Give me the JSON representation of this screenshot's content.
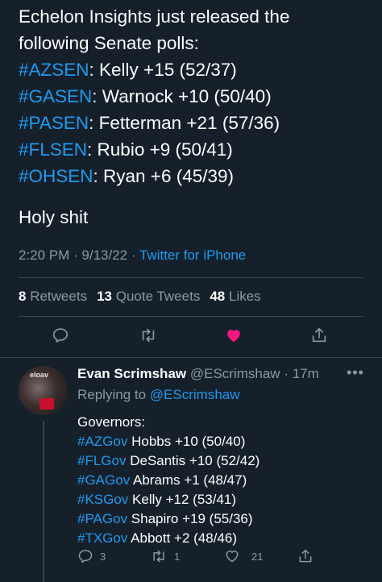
{
  "tweet": {
    "lines": [
      {
        "text": "Echelon Insights just released the"
      },
      {
        "text": "following Senate polls:"
      },
      {
        "tag": "#AZSEN",
        "rest": ": Kelly +15 (52/37)"
      },
      {
        "tag": "#GASEN",
        "rest": ": Warnock +10 (50/40)"
      },
      {
        "tag": "#PASEN",
        "rest": ": Fetterman +21 (57/36)"
      },
      {
        "tag": "#FLSEN",
        "rest": ": Rubio +9 (50/41)"
      },
      {
        "tag": "#OHSEN",
        "rest": ": Ryan +6 (45/39)"
      }
    ],
    "closing": "Holy shit",
    "time": "2:20 PM",
    "date": "9/13/22",
    "source": "Twitter for iPhone"
  },
  "stats": {
    "retweets_count": "8",
    "retweets_label": "Retweets",
    "quotes_count": "13",
    "quotes_label": "Quote Tweets",
    "likes_count": "48",
    "likes_label": "Likes"
  },
  "colors": {
    "background": "#15202b",
    "link": "#1d9bf0",
    "like": "#f91880",
    "muted": "#8b98a5"
  },
  "reply": {
    "name": "Evan Scrimshaw",
    "handle": "@EScrimshaw",
    "time": "17m",
    "replying_to_prefix": "Replying to",
    "replying_to": "@EScrimshaw",
    "avatar_logo_text": "eloav",
    "heading": "Governors:",
    "lines": [
      {
        "tag": "#AZGov",
        "rest": " Hobbs +10 (50/40)"
      },
      {
        "tag": "#FLGov",
        "rest": " DeSantis +10 (52/42)"
      },
      {
        "tag": "#GAGov",
        "rest": " Abrams +1 (48/47)"
      },
      {
        "tag": "#KSGov",
        "rest": " Kelly +12 (53/41)"
      },
      {
        "tag": "#PAGov",
        "rest": " Shapiro +19 (55/36)"
      },
      {
        "tag": "#TXGov",
        "rest": " Abbott +2 (48/46)"
      }
    ],
    "reply_count": "3",
    "retweet_count": "1",
    "like_count": "21"
  }
}
